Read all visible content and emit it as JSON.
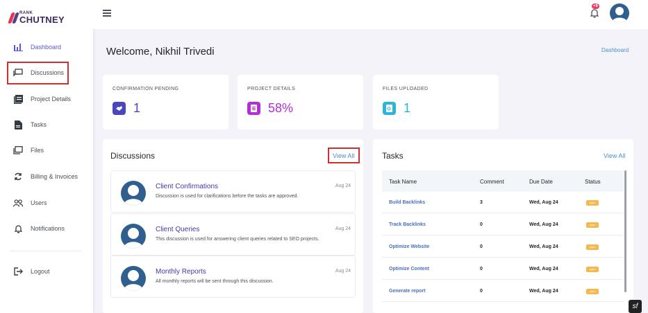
{
  "brand": {
    "small": "RANK",
    "big": "CHUTNEY"
  },
  "sidebar": {
    "items": [
      {
        "label": "Dashboard",
        "icon": "bar-chart-icon"
      },
      {
        "label": "Discussions",
        "icon": "chat-icon"
      },
      {
        "label": "Project Details",
        "icon": "list-icon"
      },
      {
        "label": "Tasks",
        "icon": "file-icon"
      },
      {
        "label": "Files",
        "icon": "files-icon"
      },
      {
        "label": "Billing & Invoices",
        "icon": "refresh-icon"
      },
      {
        "label": "Users",
        "icon": "users-icon"
      },
      {
        "label": "Notifications",
        "icon": "bell-icon"
      }
    ],
    "logout": "Logout"
  },
  "topbar": {
    "notification_count": "+9"
  },
  "page": {
    "welcome": "Welcome, Nikhil Trivedi",
    "breadcrumb": "Dashboard"
  },
  "stats": [
    {
      "title": "CONFIRMATION PENDING",
      "value": "1",
      "color": "#4b45c0"
    },
    {
      "title": "PROJECT DETAILS",
      "value": "58%",
      "color": "#b52dd6"
    },
    {
      "title": "FILES UPLOADED",
      "value": "1",
      "color": "#29b6d8"
    }
  ],
  "discussions": {
    "title": "Discussions",
    "view_all": "View All",
    "items": [
      {
        "title": "Client Confirmations",
        "desc": "Discussion is used for clarifications before the tasks are approved.",
        "date": "Aug 24"
      },
      {
        "title": "Client Queries",
        "desc": "This discussion is used for answering client queries related to SEO projects.",
        "date": "Aug 24"
      },
      {
        "title": "Monthly Reports",
        "desc": "All monthly reports will be sent through this discussion.",
        "date": "Aug 24"
      }
    ]
  },
  "tasks": {
    "title": "Tasks",
    "view_all": "View All",
    "columns": [
      "Task Name",
      "Comment",
      "Due Date",
      "Status"
    ],
    "rows": [
      {
        "name": "Build Backlinks",
        "comment": "3",
        "due": "Wed, Aug 24",
        "status": "open"
      },
      {
        "name": "Track Backlinks",
        "comment": "0",
        "due": "Wed, Aug 24",
        "status": "open"
      },
      {
        "name": "Optimize Website",
        "comment": "0",
        "due": "Wed, Aug 24",
        "status": "open"
      },
      {
        "name": "Optimize Content",
        "comment": "0",
        "due": "Wed, Aug 24",
        "status": "open"
      },
      {
        "name": "Generate report",
        "comment": "0",
        "due": "Wed, Aug 24",
        "status": "open"
      }
    ]
  },
  "colors": {
    "accent": "#5b57c8",
    "status_open": "#f7b84b",
    "highlight": "#d12f2f"
  }
}
